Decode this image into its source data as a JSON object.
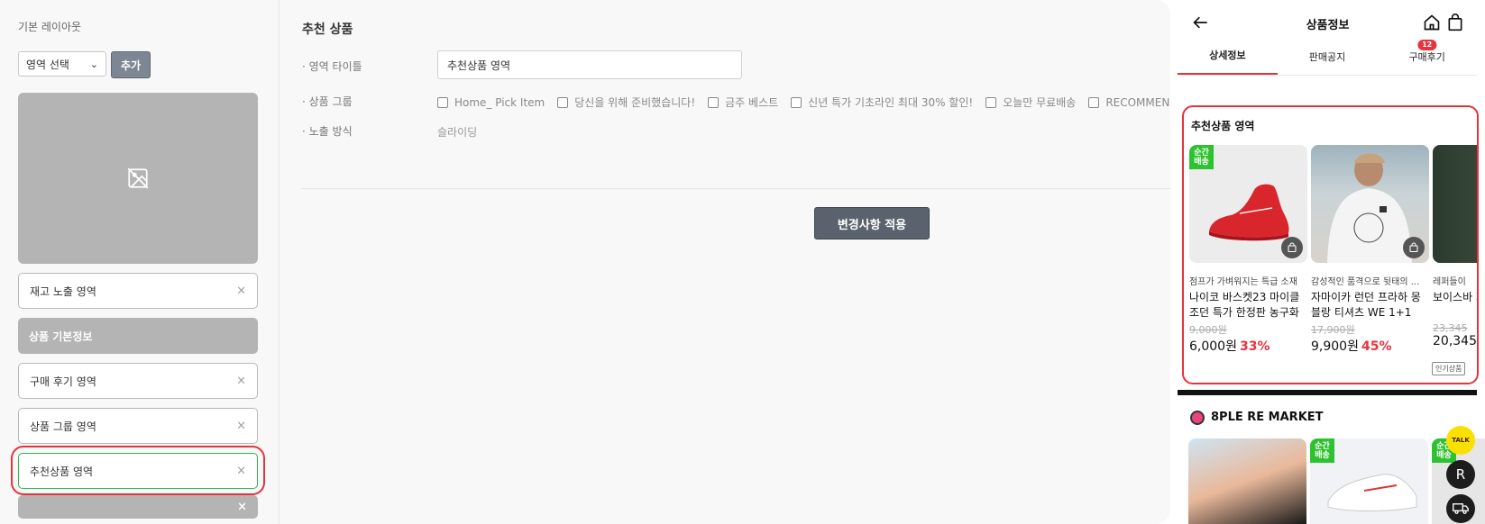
{
  "editor": {
    "left": {
      "title": "기본 레이아웃",
      "select_value": "영역 선택",
      "add_label": "추가",
      "blocks": [
        {
          "label": "재고 노출 영역",
          "close": "×"
        },
        {
          "label": "상품 기본정보"
        },
        {
          "label": "구매 후기 영역",
          "close": "×"
        },
        {
          "label": "상품 그룹 영역",
          "close": "×"
        },
        {
          "label": "추천상품 영역",
          "close": "×"
        },
        {
          "label": "",
          "close": "×"
        }
      ]
    },
    "right": {
      "section_title": "추천 상품",
      "area_title_label": "· 영역 타이틀",
      "area_title_value": "추천상품 영역",
      "group_label": "· 상품 그룹",
      "groups": [
        "Home_ Pick Item",
        "당신을 위해 준비했습니다!",
        "금주 베스트",
        "신년 특가 기초라인 최대 30% 할인!",
        "오늘만 무료배송",
        "RECOMMEND"
      ],
      "mode_label": "· 노출 방식",
      "mode_value": "슬라이딩",
      "apply_label": "변경사항 적용"
    }
  },
  "preview": {
    "title": "상품정보",
    "tabs": [
      {
        "label": "상세정보",
        "active": true
      },
      {
        "label": "판매공지"
      },
      {
        "label": "구매후기",
        "badge": "12"
      }
    ],
    "rec_title": "추천상품 영역",
    "flash_label": "순간\n배송",
    "products": [
      {
        "sub": "점프가 가벼워지는 특급 소재",
        "name": "나이코 바스켓23 마이클 조던 특가 한정판 농구화",
        "orig": "9,000원",
        "price": "6,000원",
        "disc": "33%"
      },
      {
        "sub": "감성적인 품격으로 뒷태의 ...",
        "name": "자마이카 런던 프라하 몽블랑 티셔츠 WE 1+1",
        "orig": "17,900원",
        "price": "9,900원",
        "disc": "45%"
      },
      {
        "sub": "레퍼들이",
        "name": "보이스바 자나 패션",
        "orig": "23,345",
        "price": "20,345",
        "disc": ""
      }
    ],
    "popular_tag": "인기상품",
    "market_title": "8PLE RE MARKET",
    "fab_talk": "TALK",
    "fab_r": "R"
  }
}
